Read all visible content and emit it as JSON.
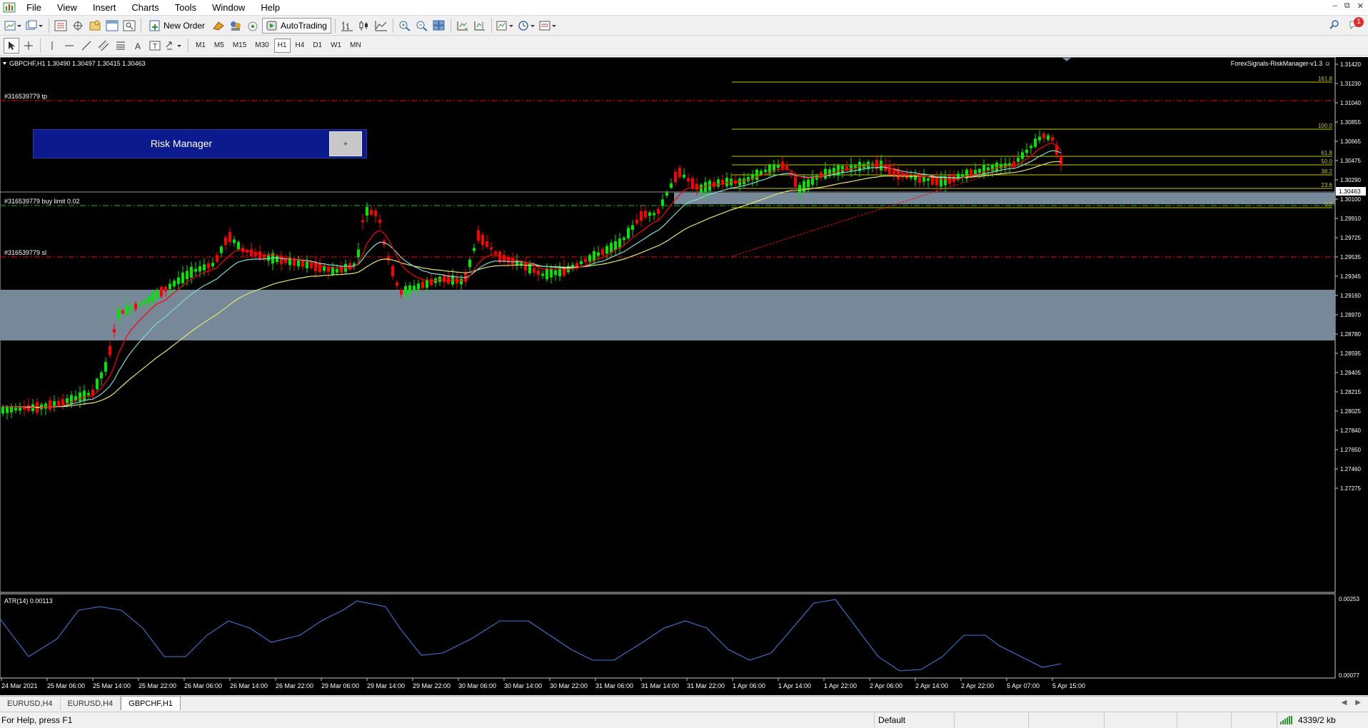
{
  "menu": [
    "File",
    "View",
    "Insert",
    "Charts",
    "Tools",
    "Window",
    "Help"
  ],
  "toolbar": {
    "new_order_label": "New Order",
    "autotrading_label": "AutoTrading",
    "timeframes": [
      "M1",
      "M5",
      "M15",
      "M30",
      "H1",
      "H4",
      "D1",
      "W1",
      "MN"
    ],
    "active_timeframe": "H1",
    "notification_count": "1"
  },
  "chart": {
    "symbol_info": "GBPCHF,H1  1.30490 1.30497 1.30415 1.30463",
    "expert_label": "ForexSignals-RiskManager-v1.3 ☺",
    "current_price": "1.30463",
    "price_axis": [
      "1.31420",
      "1.31230",
      "1.31040",
      "1.30855",
      "1.30665",
      "1.30475",
      "1.30290",
      "1.30100",
      "1.29910",
      "1.29725",
      "1.29535",
      "1.29345",
      "1.29160",
      "1.28970",
      "1.28780",
      "1.28595",
      "1.28405",
      "1.28215",
      "1.28025",
      "1.27840",
      "1.27650",
      "1.27460",
      "1.27275"
    ],
    "time_axis": [
      "24 Mar 2021",
      "25 Mar 06:00",
      "25 Mar 14:00",
      "25 Mar 22:00",
      "26 Mar 06:00",
      "26 Mar 14:00",
      "26 Mar 22:00",
      "29 Mar 06:00",
      "29 Mar 14:00",
      "29 Mar 22:00",
      "30 Mar 06:00",
      "30 Mar 14:00",
      "30 Mar 22:00",
      "31 Mar 06:00",
      "31 Mar 14:00",
      "31 Mar 22:00",
      "1 Apr 06:00",
      "1 Apr 14:00",
      "1 Apr 22:00",
      "2 Apr 06:00",
      "2 Apr 14:00",
      "2 Apr 22:00",
      "5 Apr 07:00",
      "5 Apr 15:00"
    ],
    "order_lines": {
      "tp": "#316539779 tp",
      "buy_limit": "#316539779 buy limit 0.02",
      "sl": "#316539779 sl"
    },
    "fib_levels": [
      "161.8",
      "100.0",
      "61.8",
      "50.0",
      "38.2",
      "23.6",
      "0.0"
    ],
    "risk_manager": {
      "title": "Risk Manager",
      "plus_label": "+"
    },
    "indicator": {
      "label": "ATR(14) 0.00113",
      "axis_top": "0.00253",
      "axis_bottom": "0.00077"
    },
    "colors": {
      "bull": "#00e600",
      "bear": "#ff0000",
      "zone": "#778899",
      "fib": "#c8c800",
      "order_line": "#ff0000",
      "buy_line": "#00c800",
      "ma_red": "#ff0000",
      "ma_cyan": "#7fdada",
      "ma_yellow": "#e6e66e",
      "atr": "#3c78d8"
    }
  },
  "tabs": [
    "EURUSD,H4",
    "EURUSD,H4",
    "GBPCHF,H1"
  ],
  "active_tab": "GBPCHF,H1",
  "status": {
    "help": "For Help, press F1",
    "profile": "Default",
    "traffic": "4339/2 kb"
  }
}
